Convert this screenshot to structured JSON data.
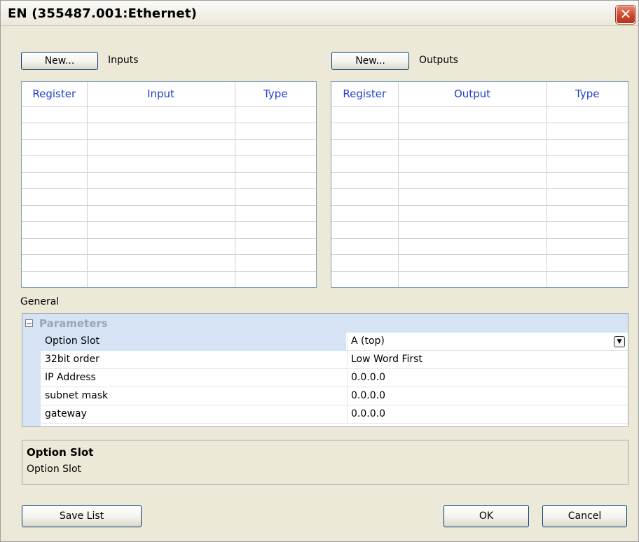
{
  "window": {
    "title": "EN (355487.001:Ethernet)",
    "close_glyph": "✕"
  },
  "inputs": {
    "new_label": "New...",
    "title": "Inputs",
    "columns": [
      "Register",
      "Input",
      "Type"
    ]
  },
  "outputs": {
    "new_label": "New...",
    "title": "Outputs",
    "columns": [
      "Register",
      "Output",
      "Type"
    ]
  },
  "general": {
    "title": "General",
    "category": "Parameters",
    "rows": [
      {
        "name": "Option Slot",
        "value": "A (top)"
      },
      {
        "name": "32bit order",
        "value": "Low Word First"
      },
      {
        "name": "IP Address",
        "value": "0.0.0.0"
      },
      {
        "name": "subnet mask",
        "value": "0.0.0.0"
      },
      {
        "name": "gateway",
        "value": "0.0.0.0"
      }
    ]
  },
  "description": {
    "title": "Option Slot",
    "text": "Option Slot"
  },
  "footer": {
    "save_label": "Save List",
    "ok_label": "OK",
    "cancel_label": "Cancel"
  },
  "icons": {
    "collapse": "collapse-minus-icon",
    "dropdown": "dropdown-arrow-icon",
    "close": "close-icon"
  },
  "colors": {
    "header_text": "#1f3fcc",
    "category_bg": "#d6e3f5",
    "close_button": "#c9432a"
  }
}
